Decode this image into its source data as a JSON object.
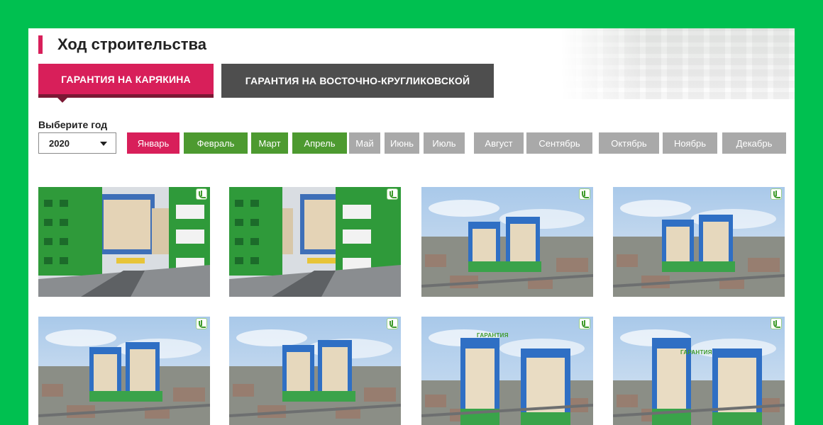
{
  "page": {
    "title": "Ход строительства"
  },
  "tabs": [
    {
      "label": "ГАРАНТИЯ НА КАРЯКИНА",
      "active": true
    },
    {
      "label": "ГАРАНТИЯ НА ВОСТОЧНО-КРУГЛИКОВСКОЙ",
      "active": false
    }
  ],
  "year_picker": {
    "label": "Выберите год",
    "selected": "2020"
  },
  "months": [
    {
      "label": "Январь",
      "state": "active"
    },
    {
      "label": "Февраль",
      "state": "available"
    },
    {
      "label": "Март",
      "state": "available"
    },
    {
      "label": "Апрель",
      "state": "available"
    },
    {
      "label": "Май",
      "state": "disabled"
    },
    {
      "label": "Июнь",
      "state": "disabled"
    },
    {
      "label": "Июль",
      "state": "disabled"
    },
    {
      "label": "Август",
      "state": "disabled"
    },
    {
      "label": "Сентябрь",
      "state": "disabled"
    },
    {
      "label": "Октябрь",
      "state": "disabled"
    },
    {
      "label": "Ноябрь",
      "state": "disabled"
    },
    {
      "label": "Декабрь",
      "state": "disabled"
    }
  ],
  "colors": {
    "accent": "#d81f5a",
    "accent_dark": "#7b1834",
    "month_available": "#4d9a30",
    "month_disabled": "#a9a9a9",
    "tab_inactive": "#4e4e4e",
    "page_background": "#00c050"
  },
  "photos": [
    {
      "scene": "street"
    },
    {
      "scene": "street"
    },
    {
      "scene": "aerial"
    },
    {
      "scene": "aerial"
    },
    {
      "scene": "aerial"
    },
    {
      "scene": "aerial"
    },
    {
      "scene": "aerial",
      "sign": "ГАРАНТИЯ"
    },
    {
      "scene": "aerial",
      "sign": "ГАРАНТИЯ"
    }
  ],
  "icons": {
    "photo_badge": "developer-logo-icon",
    "year_caret": "caret-down-icon"
  }
}
